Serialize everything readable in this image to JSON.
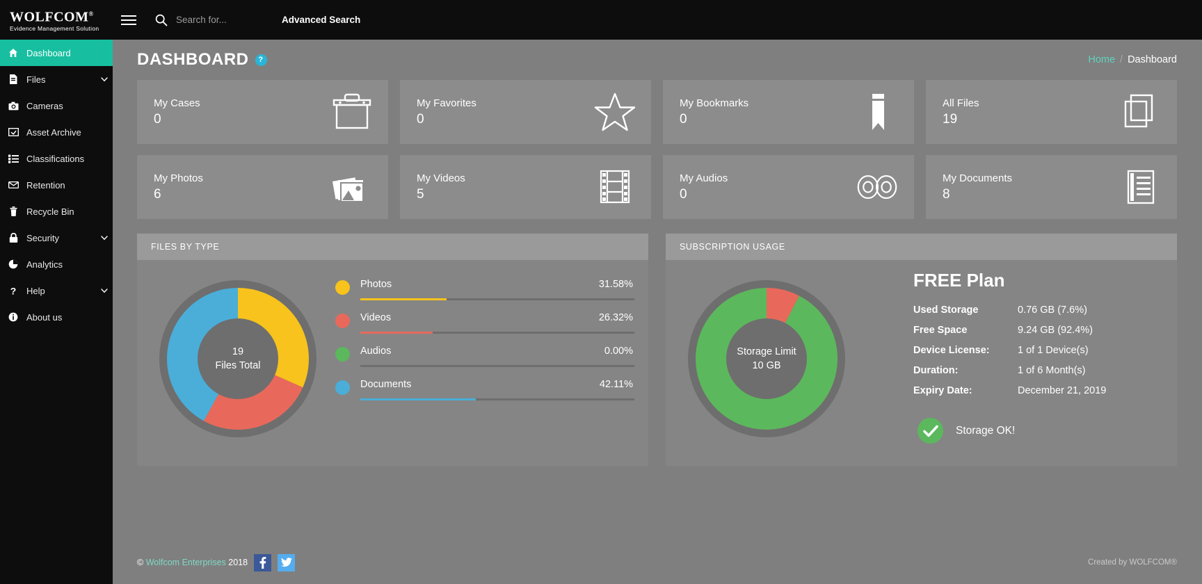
{
  "brand": {
    "name": "WOLFCOM",
    "registered": "®",
    "tagline": "Evidence Management Solution"
  },
  "topbar": {
    "menu_icon": "hamburger-icon",
    "search_icon": "search-icon",
    "search_placeholder": "Search for...",
    "search_value": "",
    "advanced_search": "Advanced Search"
  },
  "sidebar": {
    "items": [
      {
        "label": "Dashboard",
        "icon": "home-icon",
        "active": true,
        "caret": false
      },
      {
        "label": "Files",
        "icon": "file-icon",
        "active": false,
        "caret": true
      },
      {
        "label": "Cameras",
        "icon": "camera-icon",
        "active": false,
        "caret": false
      },
      {
        "label": "Asset Archive",
        "icon": "archive-icon",
        "active": false,
        "caret": false
      },
      {
        "label": "Classifications",
        "icon": "list-icon",
        "active": false,
        "caret": false
      },
      {
        "label": "Retention",
        "icon": "envelope-icon",
        "active": false,
        "caret": false
      },
      {
        "label": "Recycle Bin",
        "icon": "trash-icon",
        "active": false,
        "caret": false
      },
      {
        "label": "Security",
        "icon": "lock-icon",
        "active": false,
        "caret": true
      },
      {
        "label": "Analytics",
        "icon": "pie-chart-icon",
        "active": false,
        "caret": false
      },
      {
        "label": "Help",
        "icon": "question-mark-icon",
        "active": false,
        "caret": true
      },
      {
        "label": "About us",
        "icon": "info-icon",
        "active": false,
        "caret": false
      }
    ]
  },
  "page": {
    "title": "DASHBOARD",
    "help_badge": "?",
    "breadcrumb": {
      "home": "Home",
      "separator": "/",
      "current": "Dashboard"
    }
  },
  "cards": [
    {
      "label": "My Cases",
      "value": "0",
      "icon": "briefcase-icon"
    },
    {
      "label": "My Favorites",
      "value": "0",
      "icon": "star-icon"
    },
    {
      "label": "My Bookmarks",
      "value": "0",
      "icon": "bookmark-icon"
    },
    {
      "label": "All Files",
      "value": "19",
      "icon": "copy-files-icon"
    },
    {
      "label": "My Photos",
      "value": "6",
      "icon": "photos-icon"
    },
    {
      "label": "My Videos",
      "value": "5",
      "icon": "film-icon"
    },
    {
      "label": "My Audios",
      "value": "0",
      "icon": "audio-reels-icon"
    },
    {
      "label": "My Documents",
      "value": "8",
      "icon": "document-icon"
    }
  ],
  "files_panel": {
    "title": "FILES BY TYPE",
    "center_value": "19",
    "center_label": "Files Total"
  },
  "subscription_panel": {
    "title": "SUBSCRIPTION USAGE",
    "center_line1": "Storage Limit",
    "center_line2": "10 GB",
    "plan": "FREE Plan",
    "rows": [
      {
        "key": "Used Storage",
        "value": "0.76 GB (7.6%)"
      },
      {
        "key": "Free Space",
        "value": "9.24 GB (92.4%)"
      },
      {
        "key": "Device License:",
        "value": "1 of 1 Device(s)"
      },
      {
        "key": "Duration:",
        "value": "1 of 6 Month(s)"
      },
      {
        "key": "Expiry Date:",
        "value": "December 21, 2019"
      }
    ],
    "status_text": "Storage OK!",
    "status_icon": "check-icon"
  },
  "footer": {
    "copyright_symbol": "©",
    "company": "Wolfcom Enterprises",
    "year": "2018",
    "facebook_icon": "facebook-icon",
    "twitter_icon": "twitter-icon",
    "created_by": "Created by WOLFCOM®"
  },
  "colors": {
    "accent": "#17bfa0",
    "photos": "#f7c31c",
    "videos": "#e8695b",
    "audios": "#5cb85c",
    "documents": "#4aaed9",
    "track": "#6e6e6e",
    "used_storage": "#e8695b",
    "free_storage": "#5cb85c"
  },
  "chart_data": [
    {
      "type": "pie",
      "title": "FILES BY TYPE",
      "center_label": "19 Files Total",
      "total": 19,
      "categories": [
        "Photos",
        "Videos",
        "Audios",
        "Documents"
      ],
      "values": [
        6,
        5,
        0,
        8
      ],
      "percentages": [
        "31.58%",
        "26.32%",
        "0.00%",
        "42.11%"
      ],
      "percent_numbers": [
        31.58,
        26.32,
        0.0,
        42.11
      ],
      "colors": [
        "#f7c31c",
        "#e8695b",
        "#5cb85c",
        "#4aaed9"
      ],
      "legend_position": "right",
      "donut": true
    },
    {
      "type": "pie",
      "title": "SUBSCRIPTION USAGE",
      "center_label": "Storage Limit 10 GB",
      "categories": [
        "Used Storage",
        "Free Space"
      ],
      "values": [
        0.76,
        9.24
      ],
      "percentages": [
        "7.6%",
        "92.4%"
      ],
      "percent_numbers": [
        7.6,
        92.4
      ],
      "colors": [
        "#e8695b",
        "#5cb85c"
      ],
      "legend_position": "right",
      "donut": true
    }
  ]
}
